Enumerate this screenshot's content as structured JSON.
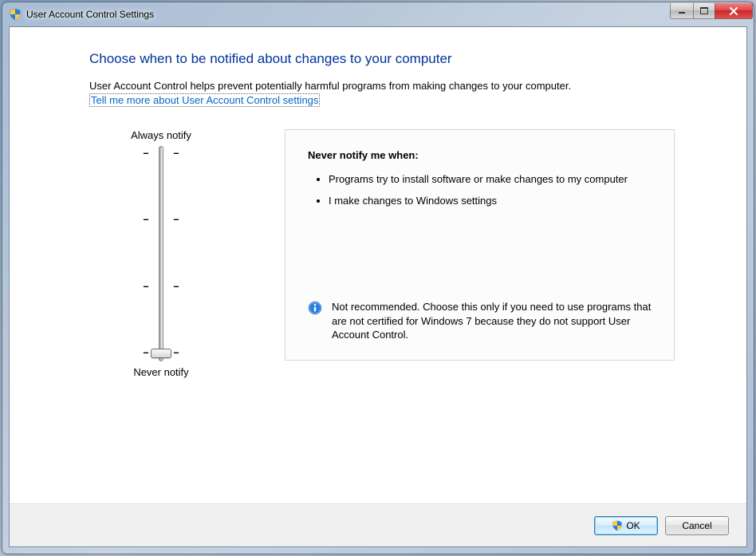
{
  "window": {
    "title": "User Account Control Settings"
  },
  "content": {
    "heading": "Choose when to be notified about changes to your computer",
    "description": "User Account Control helps prevent potentially harmful programs from making changes to your computer.",
    "link_text": "Tell me more about User Account Control settings"
  },
  "slider": {
    "top_label": "Always notify",
    "bottom_label": "Never notify",
    "position": 3
  },
  "detail": {
    "heading": "Never notify me when:",
    "bullets": [
      "Programs try to install software or make changes to my computer",
      "I make changes to Windows settings"
    ],
    "warning": "Not recommended. Choose this only if you need to use programs that are not certified for Windows 7 because they do not support User Account Control."
  },
  "buttons": {
    "ok": "OK",
    "cancel": "Cancel"
  }
}
